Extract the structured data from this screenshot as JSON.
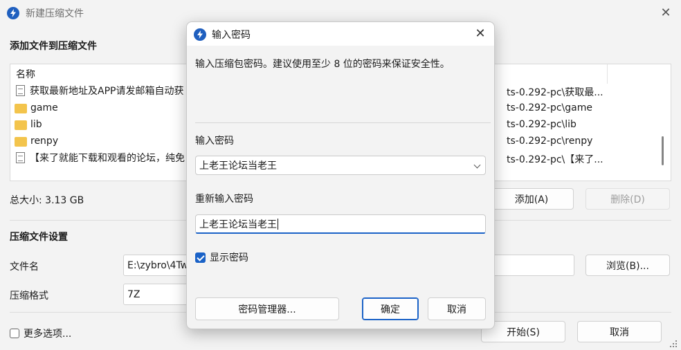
{
  "main_window": {
    "title": "新建压缩文件",
    "add_files_heading": "添加文件到压缩文件",
    "file_list": {
      "column_name": "名称",
      "rows": [
        {
          "name": "获取最新地址及APP请发邮箱自动获",
          "icon": "document-icon",
          "path": "ts-0.292-pc\\获取最..."
        },
        {
          "name": "game",
          "icon": "folder-icon",
          "path": "ts-0.292-pc\\game"
        },
        {
          "name": "lib",
          "icon": "folder-icon",
          "path": "ts-0.292-pc\\lib"
        },
        {
          "name": "renpy",
          "icon": "folder-icon",
          "path": "ts-0.292-pc\\renpy"
        },
        {
          "name": "【来了就能下载和观看的论坛，纯免",
          "icon": "document-icon",
          "path": "ts-0.292-pc\\【来了..."
        }
      ]
    },
    "total_size": "总大小: 3.13 GB",
    "add_button": "添加(A)",
    "delete_button": "删除(D)",
    "settings_heading": "压缩文件设置",
    "filename_label": "文件名",
    "filename_value": "E:\\zybro\\4Tw",
    "browse_button": "浏览(B)...",
    "format_label": "压缩格式",
    "format_value": "7Z",
    "more_options_label": "更多选项...",
    "start_button": "开始(S)",
    "cancel_button": "取消"
  },
  "dialog": {
    "title": "输入密码",
    "description": "输入压缩包密码。建议使用至少 8 位的密码来保证安全性。",
    "password_label": "输入密码",
    "password_value": "上老王论坛当老王",
    "reenter_label": "重新输入密码",
    "reenter_value": "上老王论坛当老王",
    "show_password_label": "显示密码",
    "show_password_checked": true,
    "manager_button": "密码管理器...",
    "ok_button": "确定",
    "cancel_button": "取消"
  },
  "colors": {
    "accent": "#1a62c7",
    "folder": "#f3c44c",
    "app_icon": "#1f5fbf"
  }
}
